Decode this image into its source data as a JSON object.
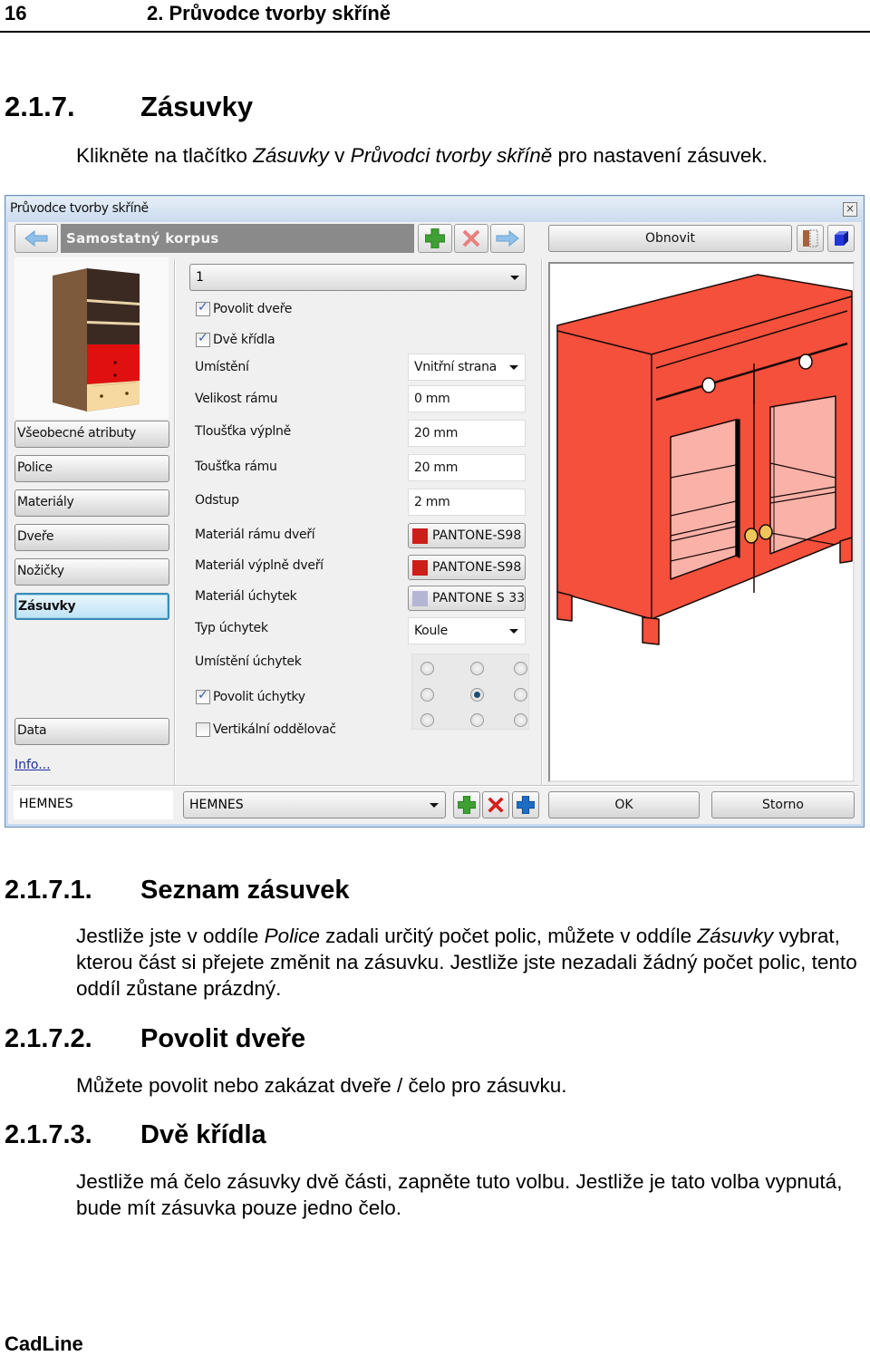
{
  "page": {
    "number": "16",
    "chapter": "2. Průvodce tvorby skříně",
    "footer": "CadLine"
  },
  "section": {
    "num": "2.1.7.",
    "title": "Zásuvky",
    "intro_parts": [
      "Klikněte na tlačítko ",
      "Zásuvky",
      " v ",
      "Průvodci tvorby skříně",
      " pro nastavení zásuvek."
    ]
  },
  "subsections": [
    {
      "num": "2.1.7.1.",
      "title": "Seznam zásuvek",
      "text_parts": [
        "Jestliže jste v oddíle ",
        "Police",
        " zadali určitý počet polic, můžete v oddíle ",
        "Zásuvky",
        " vybrat, kterou část si přejete změnit na zásuvku. Jestliže jste nezadali žádný počet polic, tento oddíl zůstane prázdný."
      ]
    },
    {
      "num": "2.1.7.2.",
      "title": "Povolit dveře",
      "text": "Můžete povolit nebo zakázat dveře / čelo pro zásuvku."
    },
    {
      "num": "2.1.7.3.",
      "title": "Dvě křídla",
      "text": "Jestliže má čelo zásuvky dvě části, zapněte tuto volbu. Jestliže je tato volba vypnutá, bude mít zásuvka pouze jedno čelo."
    }
  ],
  "dialog": {
    "title": "Průvodce tvorby skříně",
    "close_icon": "×",
    "nav_title": "Samostatný korpus",
    "refresh_label": "Obnovit",
    "sidebar": [
      {
        "label": "Všeobecné atributy",
        "active": false
      },
      {
        "label": "Police",
        "active": false
      },
      {
        "label": "Materiály",
        "active": false
      },
      {
        "label": "Dveře",
        "active": false
      },
      {
        "label": "Nožičky",
        "active": false
      },
      {
        "label": "Zásuvky",
        "active": true
      }
    ],
    "data_label": "Data",
    "info_link": "Info...",
    "drawer_select": "1",
    "enable_door": {
      "label": "Povolit dveře",
      "checked": true
    },
    "two_wings": {
      "label": "Dvě křídla",
      "checked": true
    },
    "fields": {
      "placement": {
        "label": "Umístění",
        "value": "Vnitřní strana"
      },
      "frame_size": {
        "label": "Velikost rámu",
        "value": "0 mm"
      },
      "fill_thickness": {
        "label": "Tloušťka výplně",
        "value": "20 mm"
      },
      "frame_thickness": {
        "label": "Toušťka rámu",
        "value": "20 mm"
      },
      "offset": {
        "label": "Odstup",
        "value": "2 mm"
      },
      "frame_material": {
        "label": "Materiál rámu dveří",
        "value": "PANTONE-S98",
        "color": "#cc1f1a"
      },
      "fill_material": {
        "label": "Materiál výplně dveří",
        "value": "PANTONE-S98",
        "color": "#cc1f1a"
      },
      "handle_material": {
        "label": "Materiál úchytek",
        "value": "PANTONE S 33",
        "color": "#b4b6d4"
      },
      "handle_type": {
        "label": "Typ úchytek",
        "value": "Koule"
      },
      "handle_position": {
        "label": "Umístění úchytek",
        "selected_row": 1,
        "selected_col": 1
      }
    },
    "enable_handles": {
      "label": "Povolit úchytky",
      "checked": true
    },
    "vertical_divider": {
      "label": "Vertikální oddělovač",
      "checked": false
    },
    "name_field": "HEMNES",
    "name_select": "HEMNES",
    "ok_label": "OK",
    "cancel_label": "Storno",
    "colors": {
      "cabinet_red": "#f4503c",
      "glass_pink": "#f9b1a8",
      "handle_gold": "#f0c65a"
    }
  }
}
